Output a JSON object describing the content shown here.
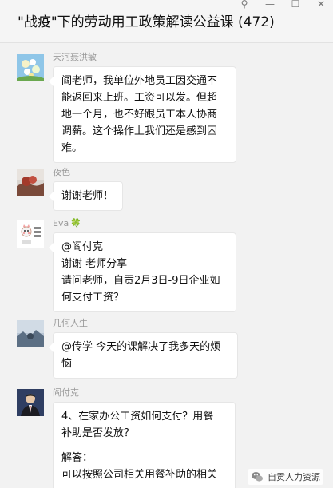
{
  "window": {
    "title": "\"战疫\"下的劳动用工政策解读公益课 (472)",
    "controls": {
      "pin": "⚲",
      "minimize": "—",
      "maximize": "☐",
      "close": "✕"
    }
  },
  "messages": [
    {
      "sender": "天河聂洪敏",
      "lines": [
        "阎老师，我单位外地员工因交通不",
        "能返回来上班。工资可以发。但超",
        "地一个月，也不好跟员工本人协商",
        "调薪。这个操作上我们还是感到困",
        "难。"
      ]
    },
    {
      "sender": "夜色",
      "lines": [
        "谢谢老师！"
      ]
    },
    {
      "sender": "Eva",
      "sender_icon": "🍀",
      "lines": [
        "@阎付克",
        "谢谢 老师分享",
        "请问老师，自贡2月3日-9日企业如",
        "何支付工资？"
      ]
    },
    {
      "sender": "几何人生",
      "lines": [
        "@传学 今天的课解决了我多天的烦",
        "恼"
      ]
    },
    {
      "sender": "阎付克",
      "lines": [
        "4、在家办公工资如何支付？用餐",
        "补助是否发放？",
        "",
        "解答：",
        "可以按照公司相关用餐补助的相关"
      ]
    }
  ],
  "watermark": {
    "text": "自贡人力资源"
  }
}
